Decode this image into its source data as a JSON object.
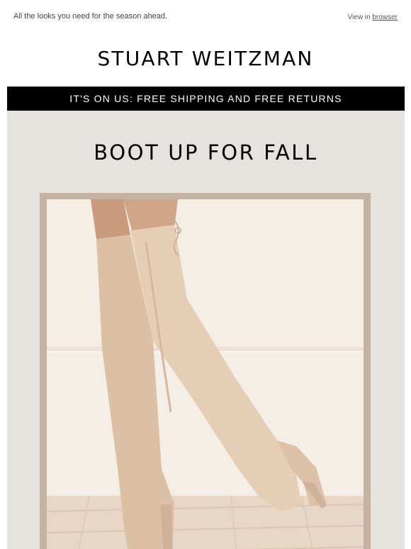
{
  "preheader": {
    "tagline": "All the looks you need for the season ahead.",
    "view_prefix": "View in",
    "view_link": "browser"
  },
  "brand": {
    "logo_text": "STUART WEITZMAN"
  },
  "promo": {
    "text": "IT'S ON US: FREE SHIPPING AND FREE RETURNS"
  },
  "hero": {
    "headline": "BOOT UP FOR FALL",
    "image_name": "over-the-knee-boots-photo"
  },
  "colors": {
    "promo_bg": "#000000",
    "hero_bg": "#e6e3df",
    "frame": "#c5b2a2",
    "boot": "#e3c9b1"
  }
}
